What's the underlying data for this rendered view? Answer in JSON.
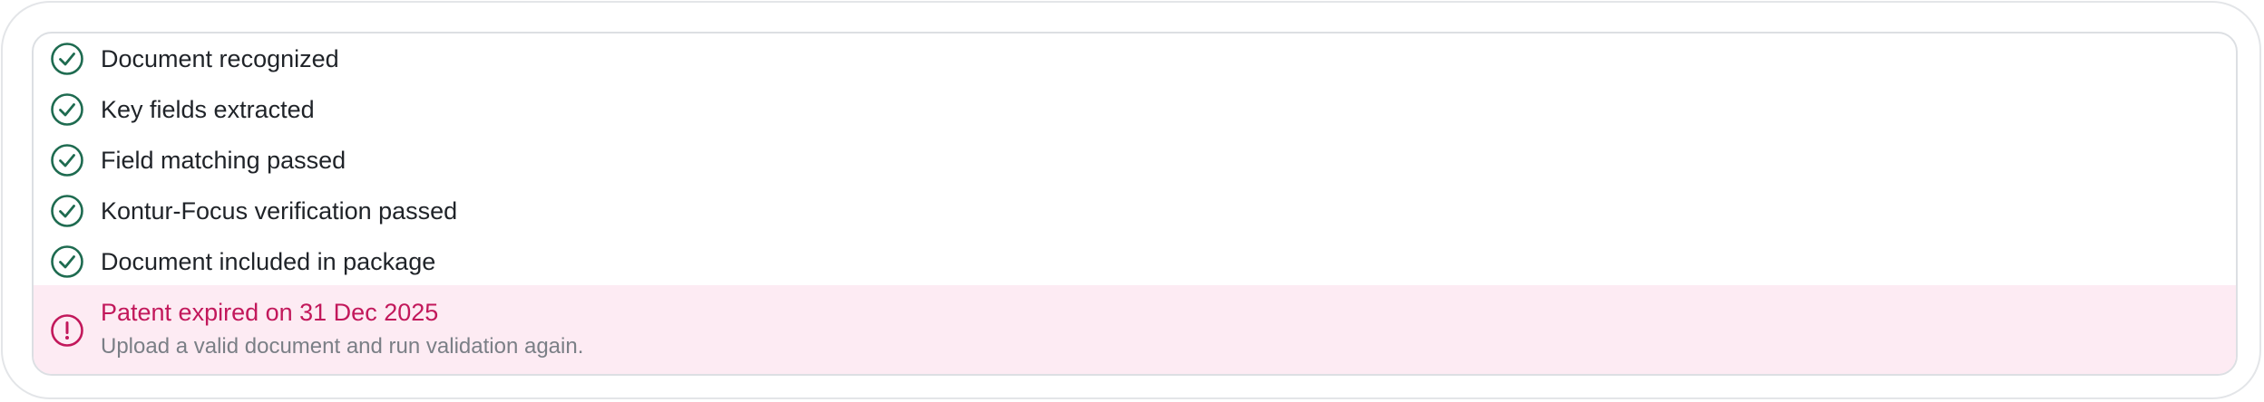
{
  "checklist": {
    "items": [
      {
        "label": "Document recognized",
        "icon": "check-circle-icon",
        "status": "passed"
      },
      {
        "label": "Key fields extracted",
        "icon": "check-circle-icon",
        "status": "passed"
      },
      {
        "label": "Field matching passed",
        "icon": "check-circle-icon",
        "status": "passed"
      },
      {
        "label": "Kontur-Focus verification passed",
        "icon": "check-circle-icon",
        "status": "passed"
      },
      {
        "label": "Document included in package",
        "icon": "check-circle-icon",
        "status": "passed"
      }
    ]
  },
  "alert": {
    "icon": "exclamation-circle-icon",
    "title": "Patent expired on 31 Dec 2025",
    "message": "Upload a valid document and run validation again."
  },
  "colors": {
    "success": "#1e6b50",
    "error": "#c2185b",
    "error_bg": "#fdebf3"
  }
}
